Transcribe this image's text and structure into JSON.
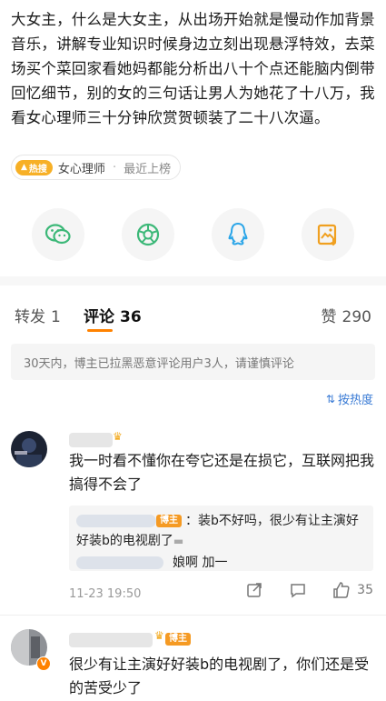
{
  "post": {
    "text": "大女主，什么是大女主，从出场开始就是慢动作加背景音乐，讲解专业知识时候身边立刻出现悬浮特效，去菜场买个菜回家看她妈都能分析出八十个点还能脑内倒带回忆细节，别的女的三句话让男人为她花了十八万，我看女心理师三十分钟欣赏贺顿装了二十八次逼。",
    "tag": {
      "badge": "热搜",
      "topic": "女心理师",
      "status": "最近上榜"
    }
  },
  "share": {
    "icons": [
      "wechat-icon",
      "moments-icon",
      "qq-icon",
      "save-image-icon"
    ]
  },
  "tabs": {
    "repost_label": "转发",
    "repost_count": "1",
    "comment_label": "评论",
    "comment_count": "36",
    "like_label": "赞",
    "like_count": "290"
  },
  "notice": "30天内，博主已拉黑恶意评论用户3人，请谨慎评论",
  "sort_label": "按热度",
  "comments": [
    {
      "text": "我一时看不懂你在夸它还是在损它，互联网把我搞得不会了",
      "replies": [
        {
          "badge": "博主",
          "text": "：装b不好吗，很少有让主演好好装b的电视剧了"
        },
        {
          "text": "娘啊  加一"
        }
      ],
      "time": "11-23 19:50",
      "likes": "35"
    },
    {
      "badge": "博主",
      "text": "很少有让主演好好装b的电视剧了，你们还是受的苦受少了"
    }
  ],
  "colors": {
    "accent": "#ff8200",
    "link": "#3a7bd5",
    "hot": "#f7b026"
  }
}
